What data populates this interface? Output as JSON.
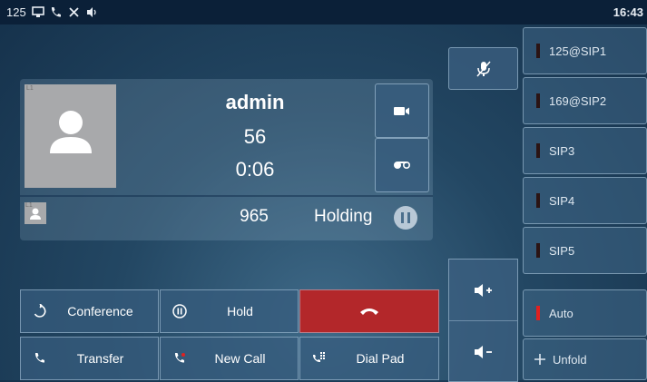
{
  "status_bar": {
    "extension": "125",
    "time": "16:43"
  },
  "call": {
    "active": {
      "line_tag": "L1",
      "name": "admin",
      "number": "56",
      "duration": "0:06"
    },
    "held": {
      "line_tag": "L1",
      "number": "965",
      "status": "Holding"
    }
  },
  "line_keys": [
    {
      "label": "125@SIP1",
      "indicator_color": "#2b1414"
    },
    {
      "label": "169@SIP2",
      "indicator_color": "#2b1414"
    },
    {
      "label": "SIP3",
      "indicator_color": "#2b1414"
    },
    {
      "label": "SIP4",
      "indicator_color": "#2b1414"
    },
    {
      "label": "SIP5",
      "indicator_color": "#2b1414"
    },
    {
      "label": "Auto",
      "indicator_color": "#e02020"
    },
    {
      "label": "Unfold",
      "indicator_color": ""
    }
  ],
  "softkeys": {
    "conference": "Conference",
    "hold": "Hold",
    "transfer": "Transfer",
    "new_call": "New Call",
    "dial_pad": "Dial Pad"
  },
  "colors": {
    "end_call": "#b3272a",
    "status_bar": "#0b2038"
  }
}
